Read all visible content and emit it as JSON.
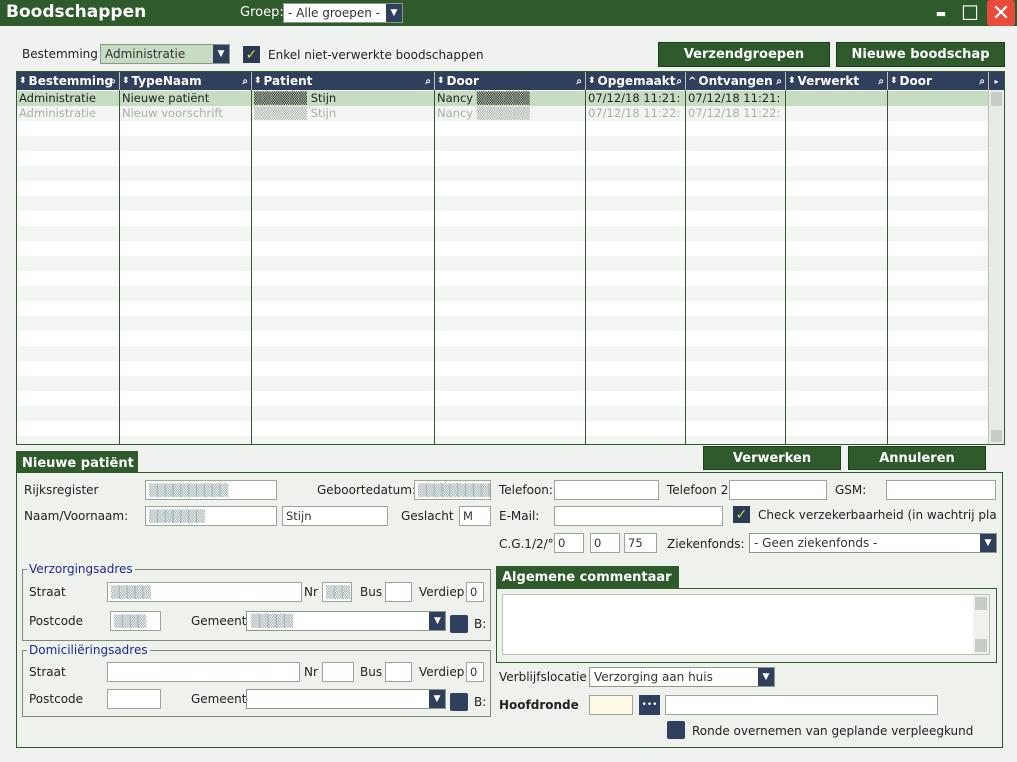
{
  "window": {
    "title": "Boodschappen",
    "groep_label": "Groep:",
    "groep_value": "- Alle groepen -",
    "minimize": "▬",
    "maximize": "☐",
    "close": "✕"
  },
  "filter": {
    "bestemming_label": "Bestemming",
    "bestemming_value": "Administratie",
    "enkel_label": "Enkel niet-verwerkte boodschappen",
    "btn_verzendgroepen": "Verzendgroepen",
    "btn_nieuwe": "Nieuwe boodschap"
  },
  "grid": {
    "columns": [
      "Bestemming",
      "TypeNaam",
      "Patient",
      "Door",
      "Opgemaakt",
      "Ontvangen",
      "Verwerkt",
      "Door"
    ],
    "sort_markers": [
      "⬍",
      "⬍",
      "⬍",
      "⬍",
      "⬍",
      "^",
      "⬍",
      "⬍"
    ],
    "rows": [
      [
        "Administratie",
        "Nieuwe patiënt",
        "▒▒▒▒▒▒ Stijn",
        "Nancy ▒▒▒▒▒▒",
        "07/12/18 11:21:",
        "07/12/18 11:21:",
        "",
        ""
      ],
      [
        "Administratie",
        "Nieuw voorschrift",
        "▒▒▒▒▒▒ Stijn",
        "Nancy ▒▒▒▒▒▒",
        "07/12/18 11:22:",
        "07/12/18 11:22:",
        "",
        ""
      ]
    ]
  },
  "actions": {
    "verwerken": "Verwerken",
    "annuleren": "Annuleren"
  },
  "form": {
    "tab": "Nieuwe patiënt",
    "rijksregister_label": "Rijksregister",
    "rijksregister_value": "▒▒▒▒▒▒▒▒▒▒",
    "geboortedatum_label": "Geboortedatum:",
    "geboortedatum_value": "▒▒▒▒▒▒▒▒▒▒",
    "telefoon_label": "Telefoon:",
    "telefoon2_label": "Telefoon 2:",
    "gsm_label": "GSM:",
    "naam_label": "Naam/Voornaam:",
    "naam_value": "▒▒▒▒▒▒▒",
    "voornaam_value": "Stijn",
    "geslacht_label": "Geslacht",
    "geslacht_value": "M",
    "email_label": "E-Mail:",
    "check_label": "Check verzekerbaarheid (in wachtrij plaa",
    "cg_label": "C.G.1/2/°",
    "cg1": "0",
    "cg2": "0",
    "cg3": "75",
    "ziekenfonds_label": "Ziekenfonds:",
    "ziekenfonds_value": "- Geen ziekenfonds -",
    "verzorgingsadres_legend": "Verzorgingsadres",
    "domicilie_legend": "Domiciliëringsadres",
    "straat_label": "Straat",
    "nr_label": "Nr",
    "bus_label": "Bus",
    "verdiep_label": "Verdiep",
    "postcode_label": "Postcode",
    "gemeente_label": "Gemeente",
    "b_label": "B:",
    "v_straat_value": "▒▒▒▒▒",
    "v_nr_value": "▒▒▒",
    "v_verdiep_value": "0",
    "v_postcode_value": "▒▒▒▒",
    "v_gemeente_value": "▒▒▒▒▒",
    "d_verdiep_value": "0",
    "commentaar_tab": "Algemene commentaar",
    "verblijf_label": "Verblijfslocatie",
    "verblijf_value": "Verzorging aan huis",
    "hoofdronde_label": "Hoofdronde",
    "dots": "•••",
    "ronde_label": "Ronde overnemen van geplande verpleegkundige"
  },
  "colors": {
    "accent_green": "#2f5a2c",
    "header_navy": "#2f3f5c",
    "selected_row": "#c8dcc4",
    "close_red": "#e84a3c"
  }
}
